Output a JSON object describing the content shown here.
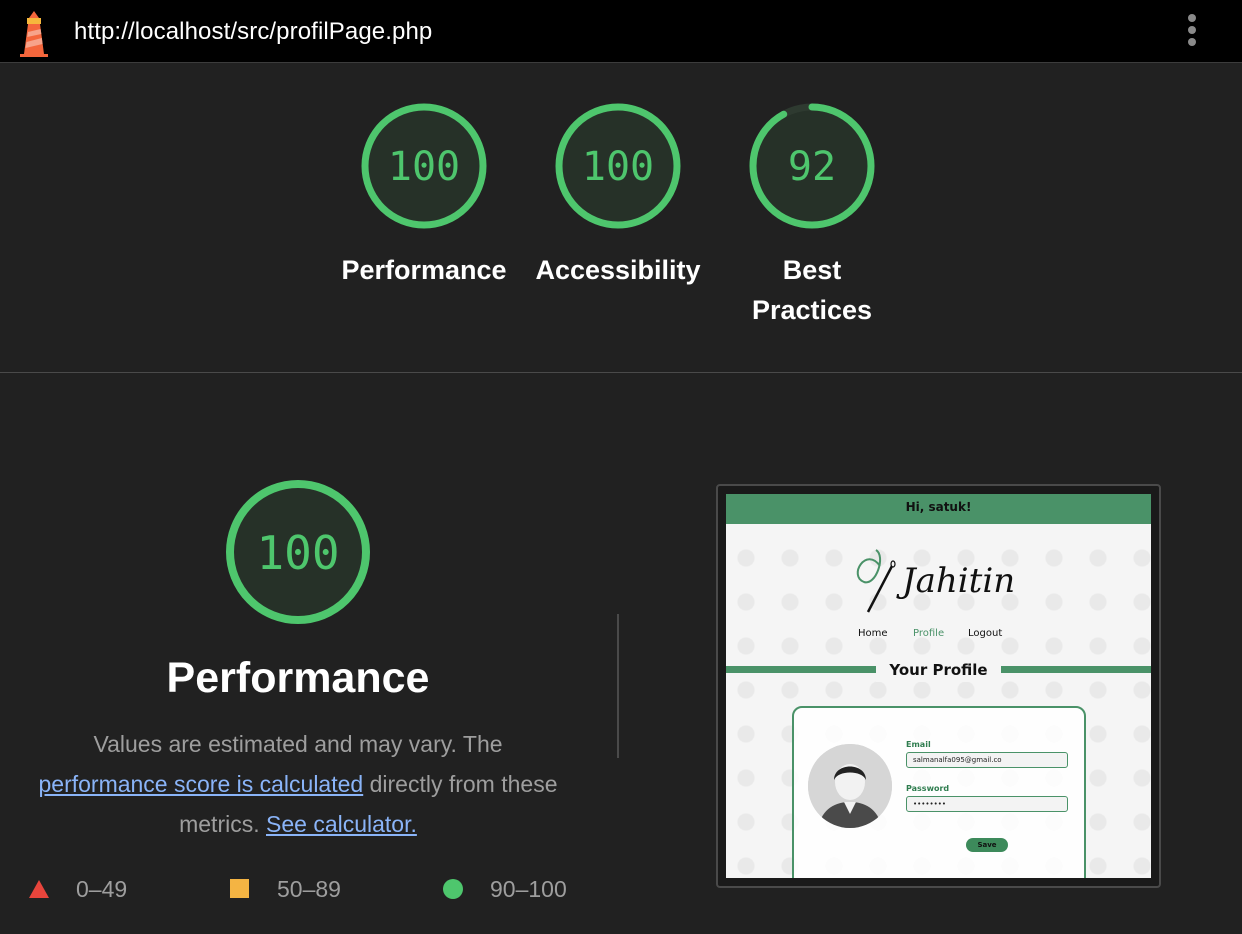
{
  "topbar": {
    "url": "http://localhost/src/profilPage.php",
    "logo_icon": "lighthouse-icon",
    "menu_icon": "more-vert-icon"
  },
  "summary": {
    "gauges": [
      {
        "label": "Performance",
        "score": 100
      },
      {
        "label": "Accessibility",
        "score": 100
      },
      {
        "label_lines": [
          "Best",
          "Practices"
        ],
        "score": 92
      }
    ],
    "pass_color": "#4ec66d"
  },
  "performance": {
    "score": 100,
    "title": "Performance",
    "desc_text_1": "Values are estimated and may vary. The",
    "desc_link_1": "performance score is calculated",
    "desc_text_2": "directly from these metrics.",
    "desc_link_2": "See calculator."
  },
  "legend": [
    {
      "range": "0–49",
      "icon": "fail-triangle-icon",
      "color": "#e8453c"
    },
    {
      "range": "50–89",
      "icon": "average-square-icon",
      "color": "#f4b443"
    },
    {
      "range": "90–100",
      "icon": "pass-circle-icon",
      "color": "#4ec66d"
    }
  ],
  "thumbnail": {
    "header": "Hi, satuk!",
    "brand": "Jahitin",
    "nav": [
      "Home",
      "Profile",
      "Logout"
    ],
    "section_title": "Your Profile",
    "email_label": "Email",
    "email_value": "salmanalfa095@gmail.co",
    "password_label": "Password",
    "password_value": "••••••••",
    "save_label": "Save",
    "accent": "#4a9268"
  }
}
